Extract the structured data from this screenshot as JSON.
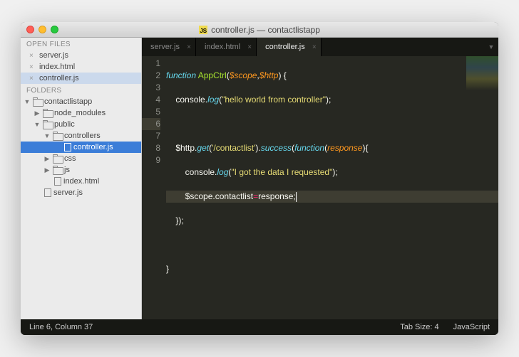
{
  "window": {
    "title": "controller.js — contactlistapp",
    "file_icon": "JS"
  },
  "sidebar": {
    "openfiles_label": "OPEN FILES",
    "openfiles": [
      {
        "name": "server.js",
        "active": false
      },
      {
        "name": "index.html",
        "active": false
      },
      {
        "name": "controller.js",
        "active": true
      }
    ],
    "folders_label": "FOLDERS",
    "tree": {
      "root": "contactlistapp",
      "items": [
        {
          "label": "node_modules",
          "type": "folder",
          "depth": 1,
          "open": false
        },
        {
          "label": "public",
          "type": "folder",
          "depth": 1,
          "open": true
        },
        {
          "label": "controllers",
          "type": "folder",
          "depth": 2,
          "open": true
        },
        {
          "label": "controller.js",
          "type": "file",
          "depth": 3,
          "selected": true
        },
        {
          "label": "css",
          "type": "folder",
          "depth": 2,
          "open": false
        },
        {
          "label": "js",
          "type": "folder",
          "depth": 2,
          "open": false
        },
        {
          "label": "index.html",
          "type": "file",
          "depth": 2
        },
        {
          "label": "server.js",
          "type": "file",
          "depth": 1
        }
      ]
    }
  },
  "tabs": [
    {
      "label": "server.js",
      "active": false
    },
    {
      "label": "index.html",
      "active": false
    },
    {
      "label": "controller.js",
      "active": true
    }
  ],
  "code": {
    "lines": [
      "1",
      "2",
      "3",
      "4",
      "5",
      "6",
      "7",
      "8",
      "9"
    ],
    "tokens": {
      "l1_function": "function",
      "l1_name": "AppCtrl",
      "l1_p1": "$scope",
      "l1_p2": "$http",
      "l2_console": "console",
      "l2_log": "log",
      "l2_str": "\"hello world from controller\"",
      "l4_http": "$http",
      "l4_get": "get",
      "l4_path": "'/contactlist'",
      "l4_success": "success",
      "l4_function": "function",
      "l4_resp": "response",
      "l5_console": "console",
      "l5_log": "log",
      "l5_str": "\"I got the data I requested\"",
      "l6_scope": "$scope",
      "l6_prop": "contactlist",
      "l6_eq": "=",
      "l6_val": "response"
    },
    "highlighted_line": 6
  },
  "status": {
    "position": "Line 6, Column 37",
    "tabsize": "Tab Size: 4",
    "syntax": "JavaScript"
  }
}
